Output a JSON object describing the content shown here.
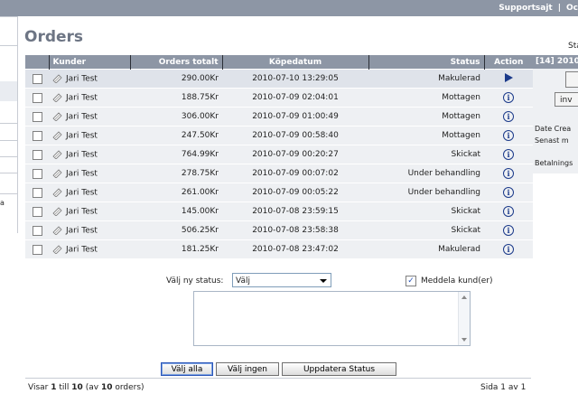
{
  "topbar": {
    "link1": "Supportsajt",
    "separator": "|",
    "link2": "Oc"
  },
  "left_panel": {
    "fragment": "a"
  },
  "page": {
    "title": "Orders"
  },
  "table": {
    "headers": {
      "kunder": "Kunder",
      "total": "Orders totalt",
      "date": "Köpedatum",
      "status": "Status",
      "action": "Action"
    },
    "rows": [
      {
        "customer": "Jari Test",
        "total": "290.00Kr",
        "date": "2010-07-10 13:29:05",
        "status": "Makulerad",
        "action_icon": "play-icon"
      },
      {
        "customer": "Jari Test",
        "total": "188.75Kr",
        "date": "2010-07-09 02:04:01",
        "status": "Mottagen",
        "action_icon": "info-icon"
      },
      {
        "customer": "Jari Test",
        "total": "306.00Kr",
        "date": "2010-07-09 01:00:49",
        "status": "Mottagen",
        "action_icon": "info-icon"
      },
      {
        "customer": "Jari Test",
        "total": "247.50Kr",
        "date": "2010-07-09 00:58:40",
        "status": "Mottagen",
        "action_icon": "info-icon"
      },
      {
        "customer": "Jari Test",
        "total": "764.99Kr",
        "date": "2010-07-09 00:20:27",
        "status": "Skickat",
        "action_icon": "info-icon"
      },
      {
        "customer": "Jari Test",
        "total": "278.75Kr",
        "date": "2010-07-09 00:07:02",
        "status": "Under behandling",
        "action_icon": "info-icon"
      },
      {
        "customer": "Jari Test",
        "total": "261.00Kr",
        "date": "2010-07-09 00:05:22",
        "status": "Under behandling",
        "action_icon": "info-icon"
      },
      {
        "customer": "Jari Test",
        "total": "145.00Kr",
        "date": "2010-07-08 23:59:15",
        "status": "Skickat",
        "action_icon": "info-icon"
      },
      {
        "customer": "Jari Test",
        "total": "506.25Kr",
        "date": "2010-07-08 23:58:38",
        "status": "Skickat",
        "action_icon": "info-icon"
      },
      {
        "customer": "Jari Test",
        "total": "181.25Kr",
        "date": "2010-07-08 23:47:02",
        "status": "Makulerad",
        "action_icon": "info-icon"
      }
    ]
  },
  "right_panel": {
    "label": "Sta",
    "header": "[14]  2010",
    "button2": "inv",
    "line1": "Date Crea",
    "line2": "Senast m",
    "line3": "Betalnings"
  },
  "form": {
    "status_label": "Välj ny status:",
    "status_value": "Välj",
    "notify_label": "Meddela kund(er)",
    "notify_checked": "✓",
    "comment_value": ""
  },
  "buttons": {
    "select_all": "Välj alla",
    "select_none": "Välj ingen",
    "update": "Uppdatera Status"
  },
  "footer": {
    "showing": "Visar",
    "from": "1",
    "to_word": "till",
    "to": "10",
    "of_open": "(av",
    "count": "10",
    "of_close": "orders)",
    "page": "Sida 1 av 1"
  },
  "colors": {
    "header_bg": "#8d96a5",
    "title": "#6d7584",
    "row_bg": "#eef0f3",
    "icon": "#1b3a8a"
  }
}
